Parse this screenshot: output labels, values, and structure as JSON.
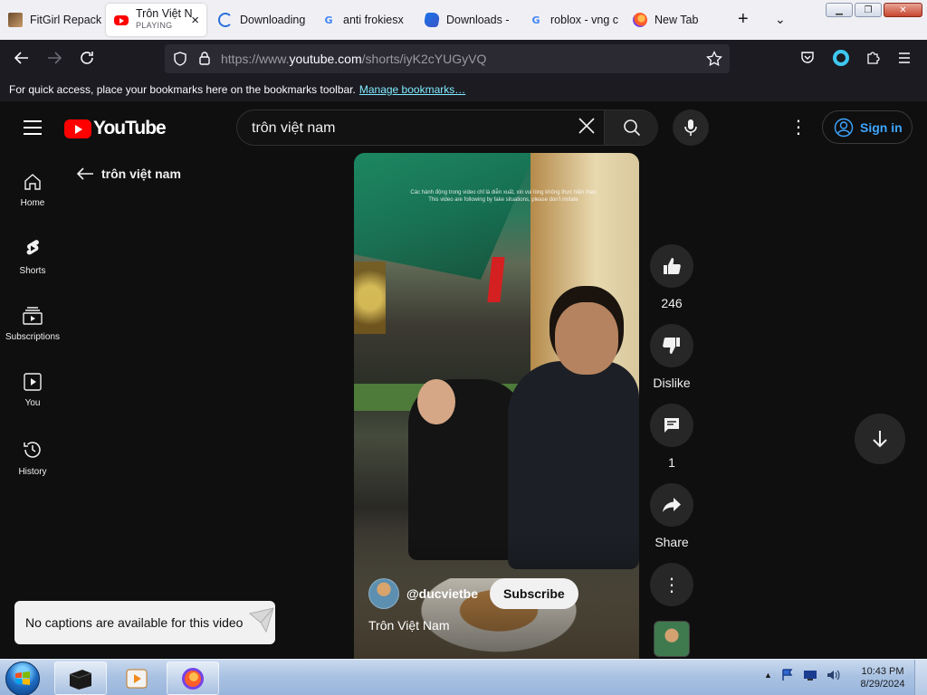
{
  "browser": {
    "tabs": [
      {
        "title": "FitGirl Repack",
        "favicon": "fitgirl-favicon"
      },
      {
        "title": "Trôn Việt N",
        "sub": "PLAYING",
        "favicon": "youtube-favicon"
      },
      {
        "title": "Downloading",
        "favicon": "loading-favicon"
      },
      {
        "title": "anti frokiesx",
        "favicon": "google-favicon"
      },
      {
        "title": "Downloads - ",
        "favicon": "edge-favicon"
      },
      {
        "title": "roblox - vng c",
        "favicon": "google-favicon"
      },
      {
        "title": "New Tab",
        "favicon": "firefox-favicon"
      }
    ],
    "url_prefix": "https://www.",
    "url_domain": "youtube.com",
    "url_path": "/shorts/iyK2cYUGyVQ",
    "bookmarks_text": "For quick access, place your bookmarks here on the bookmarks toolbar.",
    "bookmarks_link": "Manage bookmarks…"
  },
  "youtube": {
    "logo_text": "YouTube",
    "search_query": "trôn việt nam",
    "signin_label": "Sign in",
    "guide": [
      {
        "label": "Home"
      },
      {
        "label": "Shorts"
      },
      {
        "label": "Subscriptions"
      },
      {
        "label": "You"
      },
      {
        "label": "History"
      }
    ],
    "back_title": "trôn việt nam",
    "video": {
      "overlay_line1": "Các hành động trong video chỉ là diễn xuất, xin vui lòng không thực hiện theo",
      "overlay_line2": "This video are following by fake situations, please don't imitate",
      "channel_handle": "@ducvietbe",
      "subscribe_label": "Subscribe",
      "title": "Trôn Việt Nam"
    },
    "actions": {
      "like_count": "246",
      "dislike_label": "Dislike",
      "comment_count": "1",
      "share_label": "Share"
    },
    "toast": "No captions are available for this video"
  },
  "taskbar": {
    "time": "10:43 PM",
    "date": "8/29/2024"
  },
  "colors": {
    "yt_red": "#ff0000",
    "link_blue": "#3ea6ff",
    "bg": "#0f0f0f"
  }
}
